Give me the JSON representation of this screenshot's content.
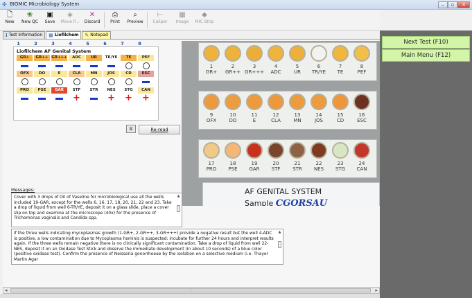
{
  "window": {
    "title": "BIOMIC Microbiology System",
    "controls": [
      "minimize",
      "maximize",
      "close"
    ]
  },
  "toolbar": {
    "buttons": [
      {
        "label": "New",
        "icon": "new-doc-icon",
        "enabled": true
      },
      {
        "label": "New QC",
        "icon": "qc-icon",
        "enabled": true
      },
      {
        "label": "Save",
        "icon": "save-icon",
        "enabled": true
      },
      {
        "label": "Move P...",
        "icon": "move-icon",
        "enabled": false
      },
      {
        "label": "Discard",
        "icon": "discard-icon",
        "enabled": true
      },
      {
        "label": "Print",
        "icon": "print-icon",
        "enabled": true
      },
      {
        "label": "Preview",
        "icon": "preview-icon",
        "enabled": true
      },
      {
        "label": "Caliper",
        "icon": "caliper-icon",
        "enabled": false
      },
      {
        "label": "Image",
        "icon": "image-icon",
        "enabled": false
      },
      {
        "label": "MIC Strip",
        "icon": "mic-strip-icon",
        "enabled": false
      }
    ]
  },
  "tabs": [
    {
      "label": "Test Information",
      "active": false
    },
    {
      "label": "Liofilchem",
      "active": true
    },
    {
      "label": "Notepad",
      "active": false
    }
  ],
  "panel": {
    "title": "Liofilchem AF Genital System",
    "column_numbers": [
      "1",
      "2",
      "3",
      "4",
      "5",
      "6",
      "7",
      "8"
    ],
    "rows": [
      {
        "tests": [
          "GR+",
          "GR++",
          "GR+++",
          "ADC",
          "UR",
          "TR/YE",
          "TE",
          "PEF"
        ],
        "results": [
          "minus",
          "minus",
          "minus",
          "minus",
          "minus",
          "minus",
          "circle",
          "circle"
        ]
      },
      {
        "tests": [
          "OFX",
          "DO",
          "E",
          "CLA",
          "MN",
          "JOS",
          "CD",
          "ESC"
        ],
        "results": [
          "circle",
          "circle",
          "circle",
          "circle",
          "circle",
          "circle",
          "circle",
          "minus"
        ]
      },
      {
        "tests": [
          "PRO",
          "PSE",
          "GAR",
          "STF",
          "STR",
          "NES",
          "STG",
          "CAN"
        ],
        "results": [
          "minus",
          "minus",
          "minus",
          "plus",
          "minus",
          "plus",
          "plus",
          "plus"
        ]
      }
    ],
    "reread_label": "Re-read"
  },
  "photo": {
    "row1": [
      {
        "num": "1",
        "code": "GR+",
        "color": "#f0b23a"
      },
      {
        "num": "2",
        "code": "GR++",
        "color": "#eeb13a"
      },
      {
        "num": "3",
        "code": "GR+++",
        "color": "#ecae39"
      },
      {
        "num": "4",
        "code": "ADC",
        "color": "#f0b33b"
      },
      {
        "num": "5",
        "code": "UR",
        "color": "#eeb03b"
      },
      {
        "num": "6",
        "code": "TR/YE",
        "color": "#f2f2ee"
      },
      {
        "num": "7",
        "code": "TE",
        "color": "#f0b63e"
      },
      {
        "num": "8",
        "code": "PEF",
        "color": "#f1bf4a"
      }
    ],
    "row2": [
      {
        "num": "9",
        "code": "OFX",
        "color": "#ee9a3c"
      },
      {
        "num": "10",
        "code": "DO",
        "color": "#ef9c3e"
      },
      {
        "num": "11",
        "code": "E",
        "color": "#ee993c"
      },
      {
        "num": "12",
        "code": "CLA",
        "color": "#ed983c"
      },
      {
        "num": "13",
        "code": "MN",
        "color": "#ee9b3e"
      },
      {
        "num": "14",
        "code": "JOS",
        "color": "#ee9b3d"
      },
      {
        "num": "15",
        "code": "CD",
        "color": "#ed963b"
      },
      {
        "num": "16",
        "code": "ESC",
        "color": "#6e3020"
      }
    ],
    "row3": [
      {
        "num": "17",
        "code": "PRO",
        "color": "#f0c989"
      },
      {
        "num": "18",
        "code": "PSE",
        "color": "#f4b777"
      },
      {
        "num": "19",
        "code": "GAR",
        "color": "#c8321d"
      },
      {
        "num": "20",
        "code": "STF",
        "color": "#79452c"
      },
      {
        "num": "21",
        "code": "STR",
        "color": "#8e6246"
      },
      {
        "num": "22",
        "code": "NES",
        "color": "#7f3b21"
      },
      {
        "num": "23",
        "code": "STG",
        "color": "#d7e7c3"
      },
      {
        "num": "24",
        "code": "CAN",
        "color": "#c3362a"
      }
    ],
    "sheet_title": "AF GENITAL SYSTEM",
    "sheet_sample_label": "Sample",
    "sheet_sample_value": "CGORSAU"
  },
  "messages": {
    "label": "Messages:",
    "box1": "Cover with 3 drops of Oil of Vaseline for microbiological use all the wells included 19-GAR, except for the wells 6, 16, 17, 18, 20, 21, 22 and 23. Take a drop of liquid from well 6-TR/YE, deposit it on a glass slide, place a cover slip on top and examine at the microscope (40x) for the presence of Trichomonas vaginalis and Candida spp.",
    "box2": "If the three wells indicating mycoplasmas growth (1-GR+, 2-GR++, 3-GR+++) provide a negative result but the well 4-ADC is positive, a low contamination due to Mycoplasma hominis is suspected: incubate for further 24 hours and interpret results again. If the three wells remain negative there is no clinically significant contamination. Take a drop of liquid from well 22-NES, deposit it on an Oxidase Test Stick and observe the immediate development (in about 10 seconds) of a blue color (positive oxidase test). Confirm the presence of Neisseria gonorrhoeae by the isolation on a selective medium (i.e. Thayer Martin Agar"
  },
  "right_panel": {
    "next_test": "Next Test (F10)",
    "main_menu": "Main Menu (F12)"
  },
  "colors": {
    "cell_orange": "#f5b247",
    "cell_yellow": "#fbe79a",
    "cell_pink": "#e5a0a0",
    "cell_peach": "#f8c88f",
    "cell_red": "#e04a2a",
    "minus_blue": "#1438c8",
    "plus_red": "#e01717",
    "right_button": "#d2f5a8",
    "right_panel_bg": "#6a6a6a"
  }
}
